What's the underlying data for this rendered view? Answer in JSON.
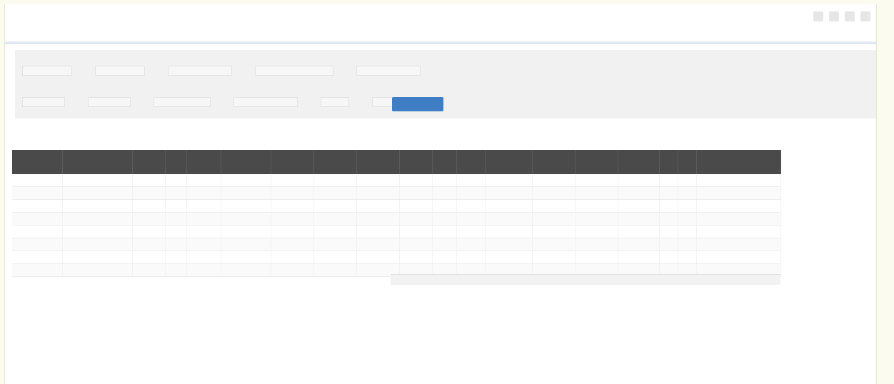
{
  "app": {
    "title": "",
    "subtitle": ""
  },
  "filters": {
    "row1": [
      {
        "label": "",
        "value": ""
      },
      {
        "label": "",
        "value": ""
      },
      {
        "label": "",
        "value": ""
      },
      {
        "label": "",
        "value": ""
      },
      {
        "label": "",
        "value": ""
      }
    ],
    "row2": [
      {
        "label": "",
        "value": ""
      },
      {
        "label": "",
        "value": ""
      },
      {
        "label": "",
        "value": ""
      },
      {
        "label": "",
        "value": ""
      },
      {
        "label": "",
        "value": ""
      },
      {
        "label": "",
        "value": ""
      }
    ],
    "search_label": ""
  },
  "results": {
    "summary": "",
    "pager": [
      "",
      ""
    ]
  },
  "table": {
    "columns": [
      "",
      "",
      "",
      "",
      "",
      "",
      "",
      "",
      "",
      "",
      "",
      "",
      "",
      "",
      "",
      "",
      "",
      "",
      ""
    ],
    "rows": [
      [
        "",
        "",
        "",
        "",
        "",
        "",
        "",
        "",
        "",
        "",
        "",
        "",
        "",
        "",
        "",
        "",
        "",
        "",
        ""
      ],
      [
        "",
        "",
        "",
        "",
        "",
        "",
        "",
        "",
        "",
        "",
        "",
        "",
        "",
        "",
        "",
        "",
        "",
        "",
        ""
      ],
      [
        "",
        "",
        "",
        "",
        "",
        "",
        "",
        "",
        "",
        "",
        "",
        "",
        "",
        "",
        "",
        "",
        "",
        "",
        ""
      ],
      [
        "",
        "",
        "",
        "",
        "",
        "",
        "",
        "",
        "",
        "",
        "",
        "",
        "",
        "",
        "",
        "",
        "",
        "",
        ""
      ],
      [
        "",
        "",
        "",
        "",
        "",
        "",
        "",
        "",
        "",
        "",
        "",
        "",
        "",
        "",
        "",
        "",
        "",
        "",
        ""
      ],
      [
        "",
        "",
        "",
        "",
        "",
        "",
        "",
        "",
        "",
        "",
        "",
        "",
        "",
        "",
        "",
        "",
        "",
        "",
        ""
      ],
      [
        "",
        "",
        "",
        "",
        "",
        "",
        "",
        "",
        "",
        "",
        "",
        "",
        "",
        "",
        "",
        "",
        "",
        "",
        ""
      ],
      [
        "",
        "",
        "",
        "",
        "",
        "",
        "",
        "",
        "",
        "",
        "",
        "",
        "",
        "",
        "",
        "",
        "",
        "",
        ""
      ]
    ]
  },
  "side_notes": [
    "",
    "",
    "",
    "",
    "",
    "",
    "",
    "",
    ""
  ],
  "colors": {
    "accent": "#3f7ec4",
    "header_bg": "#4a4a4a",
    "panel_bg": "#f1f1f1",
    "page_bg": "#fbfbef"
  }
}
